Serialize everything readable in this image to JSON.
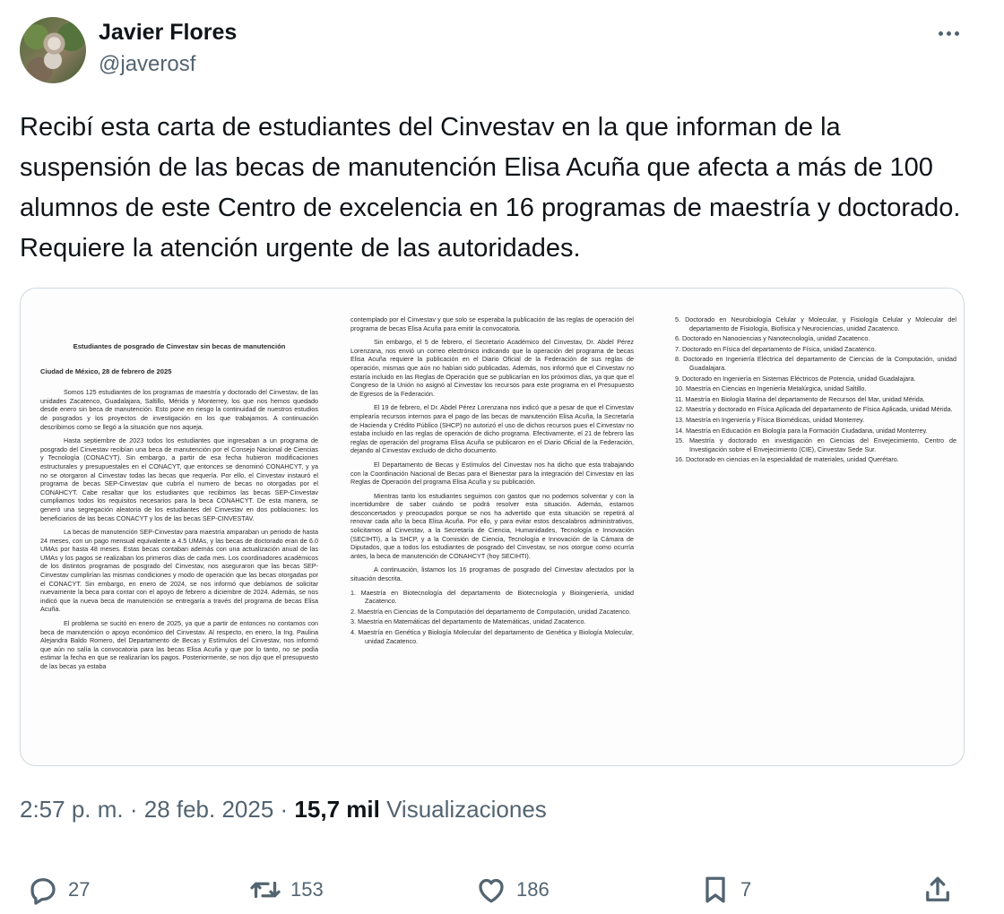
{
  "author": {
    "display_name": "Javier Flores",
    "handle": "@javerosf"
  },
  "tweet": {
    "text": "Recibí esta carta de estudiantes del Cinvestav en la que informan de la suspensión de las becas de manutención Elisa Acuña que afecta a más de 100 alumnos de este Centro de excelencia en 16 programas de maestría y doctorado. Requiere la atención urgente de las autoridades."
  },
  "document": {
    "title": "Estudiantes de posgrado de Cinvestav sin becas de manutención",
    "date_line": "Ciudad de México, 28 de febrero de 2025",
    "col1_paragraphs": [
      "Somos 125 estudiantes de los programas de maestría y doctorado del Cinvestav, de las unidades Zacatenco, Guadalajara, Saltillo, Mérida y Monterrey, los que nos hemos quedado desde enero sin beca de manutención. Esto pone en riesgo la continuidad de nuestros estudios de posgrados y los proyectos de investigación en los que trabajamos. A continuación describimos como se llegó a la situación que nos aqueja.",
      "Hasta septiembre de 2023 todos los estudiantes que ingresaban a un programa de posgrado del Cinvestav recibían una beca de manutención por el Consejo Nacional de Ciencias y Tecnología (CONACYT). Sin embargo, a partir de esa fecha hubieron modificaciones estructurales y presupuestales en el CONACYT, que entonces se denominó CONAHCYT, y ya no se otorgaron al Cinvestav todas las becas que requería. Por ello, el Cinvestav instauró el programa de becas SEP-Cinvestav que cubría el numero de becas no otorgadas por el CONAHCYT. Cabe resaltar que los estudiantes que recibimos las becas SEP-Cinvestav cumpliamos todos los requisitos necesarios para la beca CONAHCYT. De esta manera, se generó una segregación aleatoria de los estudiantes del Cinvestav en dos poblaciones: los beneficiarios de las becas CONACYT y los de las becas SEP-CINVESTAV.",
      "La becas de manutención SEP-Cinvestav para maestría amparaban un periodo de hasta 24 meses, con un pago mensual equivalente a 4.5 UMAs, y las becas de doctorado eran de 6.0 UMAs por hasta 48 meses. Estas becas contaban además con una actualización anual de las UMAs y los pagos se realizaban los primeros días de cada mes. Los coordinadores académicos de los distintos programas de posgrado del Cinvestav, nos aseguraron que las becas SEP-Cinvestav cumplirían las mismas condiciones y modo de operación que las becas otorgadas por el CONACYT. Sin embargo, en enero de 2024, se nos informó que debíamos de solicitar nuevamente la beca para contar con el apoyo de febrero a diciembre de 2024. Además, se nos indicó que la nueva beca de manutención se entregaría a través del programa de becas Elisa Acuña.",
      "El problema se sucitó en enero de 2025, ya que a partir de entonces no contamos con beca de manutención o apoyo económico del Cinvestav. Al respecto, en enero, la Ing. Paulina Alejandra Baldo Romero, del Departamento de Becas y Estímulos del Cinvestav, nos informó que aún no salía la convocatoria para las becas Elisa Acuña y que por lo tanto, no se podía estimar la fecha en que se realizarían los pagos. Posteriormente, se nos dijo que el presupuesto de las becas ya estaba"
    ],
    "col2_paragraphs": [
      "contemplado por el Cinvestav y que solo se esperaba la publicación de las reglas de operación del programa de becas Elisa Acuña para emitir la convocatoria.",
      "Sin embargo, el 5 de febrero, el Secretario Académico del Cinvestav, Dr. Abdel Pérez Lorenzana, nos envió un correo electrónico indicando que la operación del programa de becas Elisa Acuña requiere la publicación en el Diario Oficial de la Federación de sus reglas de operación, mismas que aún no habían sido publicadas. Además, nos informó que el Cinvestav no estaría incluido en las Reglas de Operación que se publicarían en los próximos días, ya que que el Congreso de la Unión no asignó al Cinvestav los recursos para este programa en el Presupuesto de Egresos de la Federación.",
      "El 19 de febrero, el Dr. Abdel Pérez Lorenzana nos indicó que a pesar de que el Cinvestav emplearía recursos internos para el pago de las becas de manutención Elisa Acuña, la Secretaría de Hacienda y Crédito Público (SHCP) no autorizó el uso de dichos recursos pues el Cinvestav no estaba incluido en las reglas de operación de dicho programa. Efectivamente, el 21 de febrero las reglas de operación del programa Elisa Acuña se publicaron en el Diario Oficial de la Federación, dejando al Cinvestav excluido de dicho documento.",
      "El Departamento de Becas y Estímulos del Cinvestav nos ha dicho que esta trabajando con la Coordinación Nacional de Becas para el Bienestar para la integración del Cinvestav en las Reglas de Operación del programa Elisa Acuña y su publicación.",
      "Mientras tanto los estudiantes seguimos con gastos que no podemos solventar y con la incertidumbre de saber cuándo se podrá resolver esta situación. Además, estamos desconcertados y preocupados porque se nos ha advertido que esta situación se repetirá al renovar cada año la beca Elisa Acuña. Por ello, y para evitar estos descalabros administrativos, solicitamos al Cinvestav, a la Secretaría de Ciencia, Humanidades, Tecnología e Innovación (SECIHTI), a la SHCP, y a la Comisión de Ciencia, Tecnología e Innovación de la Cámara de Diputados, que a todos los estudiantes de posgrado del Cinvestav, se nos otorgue como ocurría antes, la beca de manutención de CONAHCYT (hoy SECIHTI).",
      "A continuación, listamos los 16 programas de posgrado del Cinvestav afectados por la situación descrita."
    ],
    "col2_list": [
      "1.  Maestría en Biotecnología del departamento de Biotecnología y Bioingeniería, unidad Zacatenco.",
      "2.  Maestría en Ciencias de la Computación del departamento de Computación, unidad Zacatenco.",
      "3.  Maestría en Matemáticas del departamento de Matemáticas, unidad Zacatenco.",
      "4.  Maestría en Genética y Biología Molecular del departamento de Genética y Biología Molecular, unidad Zacatenco."
    ],
    "col3_list": [
      "5.  Doctorado en Neurobiología Celular y Molecular, y Fisiología Celular y Molecular del departamento de Fisiología, Biofísica y Neurociencias, unidad Zacatenco.",
      "6.  Doctorado en Nanociencias y Nanotecnología, unidad Zacatenco.",
      "7.  Doctorado en Física del departamento de Física, unidad Zacatenco.",
      "8.  Doctorado en Ingeniería Eléctrica del departamento de Ciencias de la Computación, unidad Guadalajara.",
      "9.  Doctorado en Ingeniería en Sistemas Eléctricos de Potencia, unidad Guadalajara.",
      "10. Maestría en Ciencias en Ingeniería Metalúrgica, unidad Saltillo.",
      "11. Maestría en Biología Marina del departamento de Recursos del Mar, unidad Mérida.",
      "12. Maestría y doctorado en Física Aplicada del departamento de Física Aplicada, unidad Mérida.",
      "13. Maestría en Ingeniería y Física Biomédicas, unidad Monterrey.",
      "14. Maestría en Educación en Biología para la Formación Ciudadana, unidad Monterrey.",
      "15. Maestría y doctorado en investigación en Ciencias del Envejecimiento, Centro de Investigación sobre el Envejecimiento (CIE), Cinvestav Sede Sur.",
      "16. Doctorado en ciencias en la especialidad de materiales, unidad Querétaro."
    ]
  },
  "meta": {
    "time": "2:57 p. m.",
    "separator": " · ",
    "date": "28 feb. 2025",
    "views_count": "15,7 mil",
    "views_label": "Visualizaciones"
  },
  "actions": {
    "replies": "27",
    "reposts": "153",
    "likes": "186",
    "bookmarks": "7"
  },
  "icons": [
    "more-icon",
    "reply-icon",
    "repost-icon",
    "like-icon",
    "bookmark-icon",
    "share-icon"
  ]
}
